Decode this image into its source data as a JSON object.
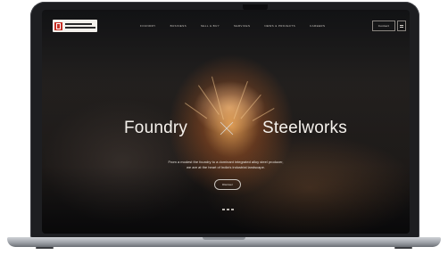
{
  "nav": {
    "logo_name": "industrial-logo",
    "links": [
      "Foundry",
      "Business",
      "Sell & Buy",
      "Services",
      "News & Projects",
      "Careers"
    ],
    "contact_label": "Contact",
    "menu_icon": "menu-icon"
  },
  "hero": {
    "title_left": "Foundry",
    "title_right": "Steelworks",
    "separator_icon": "x-cross-icon",
    "subtitle_line1": "From a modest the foundry to a dominant integrated alloy steel producer,",
    "subtitle_line2": "we are at the heart of India's industrial landscape.",
    "cta_label": "Discover",
    "scroll_icon": "scroll-dots-icon"
  },
  "colors": {
    "logo_red": "#c62f25",
    "hero_text": "#f5f1ec",
    "glow": "#ffb05a"
  }
}
